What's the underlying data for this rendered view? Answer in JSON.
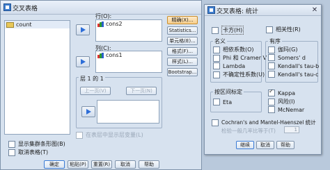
{
  "main": {
    "title": "交叉表格",
    "source_items": [
      {
        "name": "count",
        "icon": "ruler-icon"
      }
    ],
    "row_label": "行(O):",
    "row_items": [
      {
        "name": "cons2"
      }
    ],
    "col_label": "列(C):",
    "col_items": [
      {
        "name": "cons1"
      }
    ],
    "layer_label": "层 1 的 1",
    "prev_label": "上一页(V)",
    "next_label": "下一页(N)",
    "layer_display_label": "在表层中显示层变量(L)",
    "side_buttons": [
      "精确(X)...",
      "Statistics...",
      "单元格(E)...",
      "格式(F)...",
      "样式(L)...",
      "Bootstrap..."
    ],
    "clustered_bar_label": "显示集群条形图(B)",
    "suppress_tables_label": "取消表格(T)",
    "footer_buttons": [
      "确定",
      "粘贴(P)",
      "重置(R)",
      "取消",
      "帮助"
    ]
  },
  "stats": {
    "title": "交叉表格: 统计",
    "chisq_label": "卡方(H)",
    "corr_label": "相关性(R)",
    "nominal_title": "名义",
    "nominal_items": [
      "相依系数(O)",
      "Phi 和 Cramer V",
      "Lambda",
      "不确定性系数(U)"
    ],
    "ordinal_title": "有序",
    "ordinal_items": [
      "伽玛(G)",
      "Somers' d",
      "Kendall's tau-b",
      "Kendall's tau-c"
    ],
    "interval_title": "按区间标定",
    "eta_label": "Eta",
    "kappa_label": "Kappa",
    "risk_label": "风险(I)",
    "mcnemar_label": "McNemar",
    "cmh_label": "Cochran's and Mantel-Haenszel 统计",
    "common_odds_label": "检验一般几率比等于(T)",
    "common_odds_value": "1",
    "footer_buttons": [
      "继续",
      "取消",
      "帮助"
    ]
  }
}
